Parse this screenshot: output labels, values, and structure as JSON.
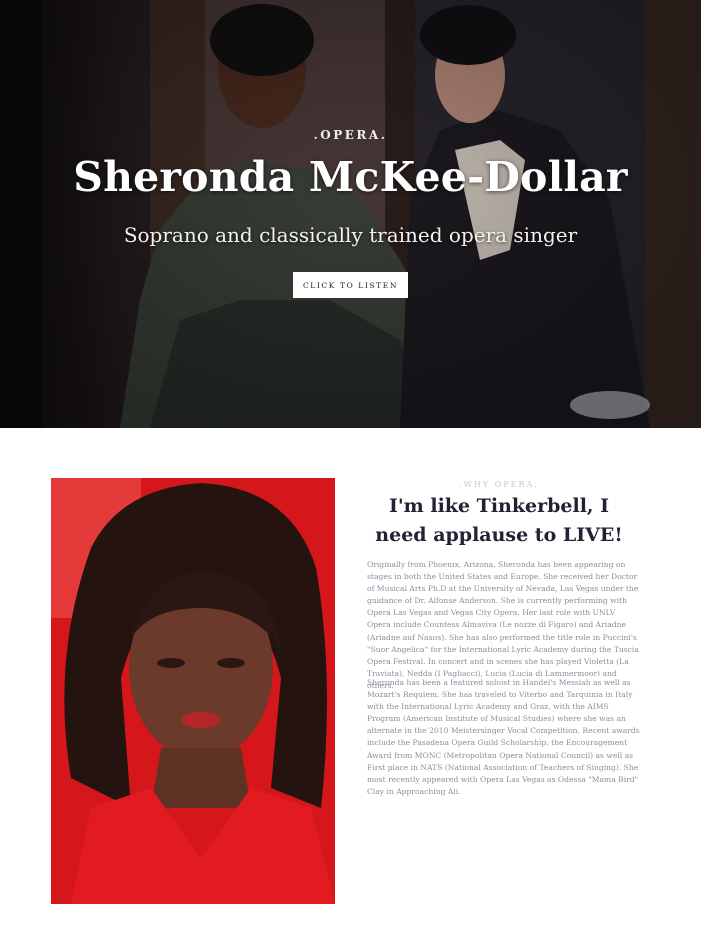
{
  "hero": {
    "kicker": ".OPERA.",
    "title": "Sheronda McKee-Dollar",
    "subtitle": "Soprano and classically trained opera singer",
    "cta_label": "CLICK TO LISTEN",
    "image_icon": "opera-stage-photo"
  },
  "about": {
    "kicker": ".WHY OPERA.",
    "heading": "I'm like Tinkerbell, I need applause to LIVE!",
    "paragraphs": [
      "Originally from Phoenix, Arizona, Sheronda has been appearing on stages in both the United States and Europe. She received her Doctor of Musical Arts Ph.D at the University of Nevada, Las Vegas under the guidance of Dr. Alfonse Anderson. She is currently performing with Opera Las Vegas and Vegas City Opera. Her last role with UNLV Opera include Countess Almaviva (Le nozze di Figaro) and Ariadne (Ariadne auf Naxos). She has also performed the title role in Puccini's \"Suor Angelica\" for the International Lyric Academy during the Tuscia Opera Festival. In concert and in scenes she has played Violetta (La Traviata), Nedda (I Pagliacci), Lucia (Lucia di Lammermoor) and others.",
      "Sheronda has been a featured soloist in Handel's Messiah as well as Mozart's Requiem. She has traveled to Viterbo and Tarquinia in Italy with the International Lyric Academy and Graz, with the AIMS Program (American Institute of Musical Studies) where she was an alternate in the 2010 Meistersinger Vocal Competition. Recent awards include the Pasadena Opera Guild Scholarship, the Encouragement Award from MONC (Metropolitan Opera National Council) as well as First place in NATS (National Association of Teachers of Singing). She most recently appeared with Opera Las Vegas as Odessa \"Mama Bird\" Clay in Approaching Ali."
    ],
    "portrait_icon": "portrait-photo"
  },
  "colors": {
    "heading": "#222235",
    "body_text": "#8d8d9c",
    "portrait_red": "#d71a1a"
  }
}
